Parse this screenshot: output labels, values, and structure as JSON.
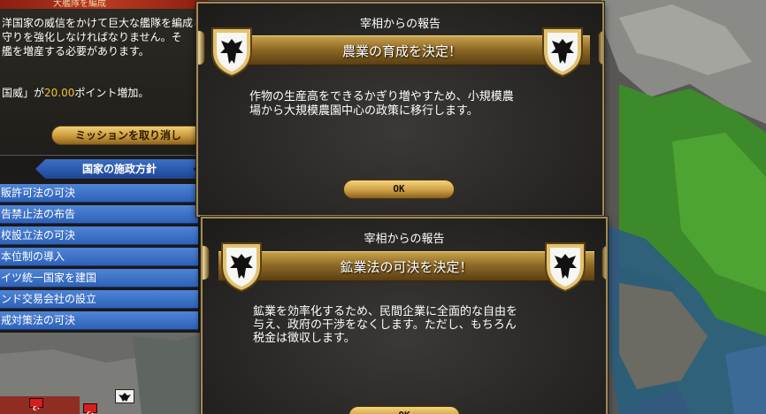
{
  "mission": {
    "title": "大艦隊を編成",
    "lines": [
      "洋国家の威信をかけて巨大な艦隊を編成し、海岸線",
      "守りを強化しなければなりません。そ",
      "艦を増産する必要があります。"
    ],
    "reward_prefix": "国威」が",
    "reward_value": "20.00",
    "reward_suffix": "ポイント増加。",
    "cancel_label": "ミッションを取り消し"
  },
  "policy": {
    "header": "国家の施政方針",
    "items": [
      "販許可法の可決",
      "告禁止法の布告",
      "校設立法の可決",
      "本位制の導入",
      "イツ統一国家を建国",
      "ンド交易会社の設立",
      "戒対策法の可決"
    ]
  },
  "dialogs": [
    {
      "title": "宰相からの報告",
      "headline": "農業の育成を決定！",
      "body": [
        "作物の生産高をできるかぎり増やすため、小規模農",
        "場から大規模農園中心の政策に移行します。"
      ],
      "ok_label": "OK"
    },
    {
      "title": "宰相からの報告",
      "headline": "鉱業法の可決を決定！",
      "body": [
        "鉱業を効率化するため、民間企業に全面的な自由を",
        "与え、政府の干渉をなくします。ただし、もちろん",
        "税金は徴収します。"
      ],
      "ok_label": "OK"
    }
  ],
  "colors": {
    "accent_gold": "#c8a24c",
    "policy_blue": "#2e62b8",
    "reward_number": "#f2c230",
    "forest_green": "#3d8a2a",
    "sea_blue": "#2d5a86"
  },
  "icons": [
    "eagle-crest-icon",
    "turkey-flag-icon",
    "prussia-flag-icon"
  ]
}
